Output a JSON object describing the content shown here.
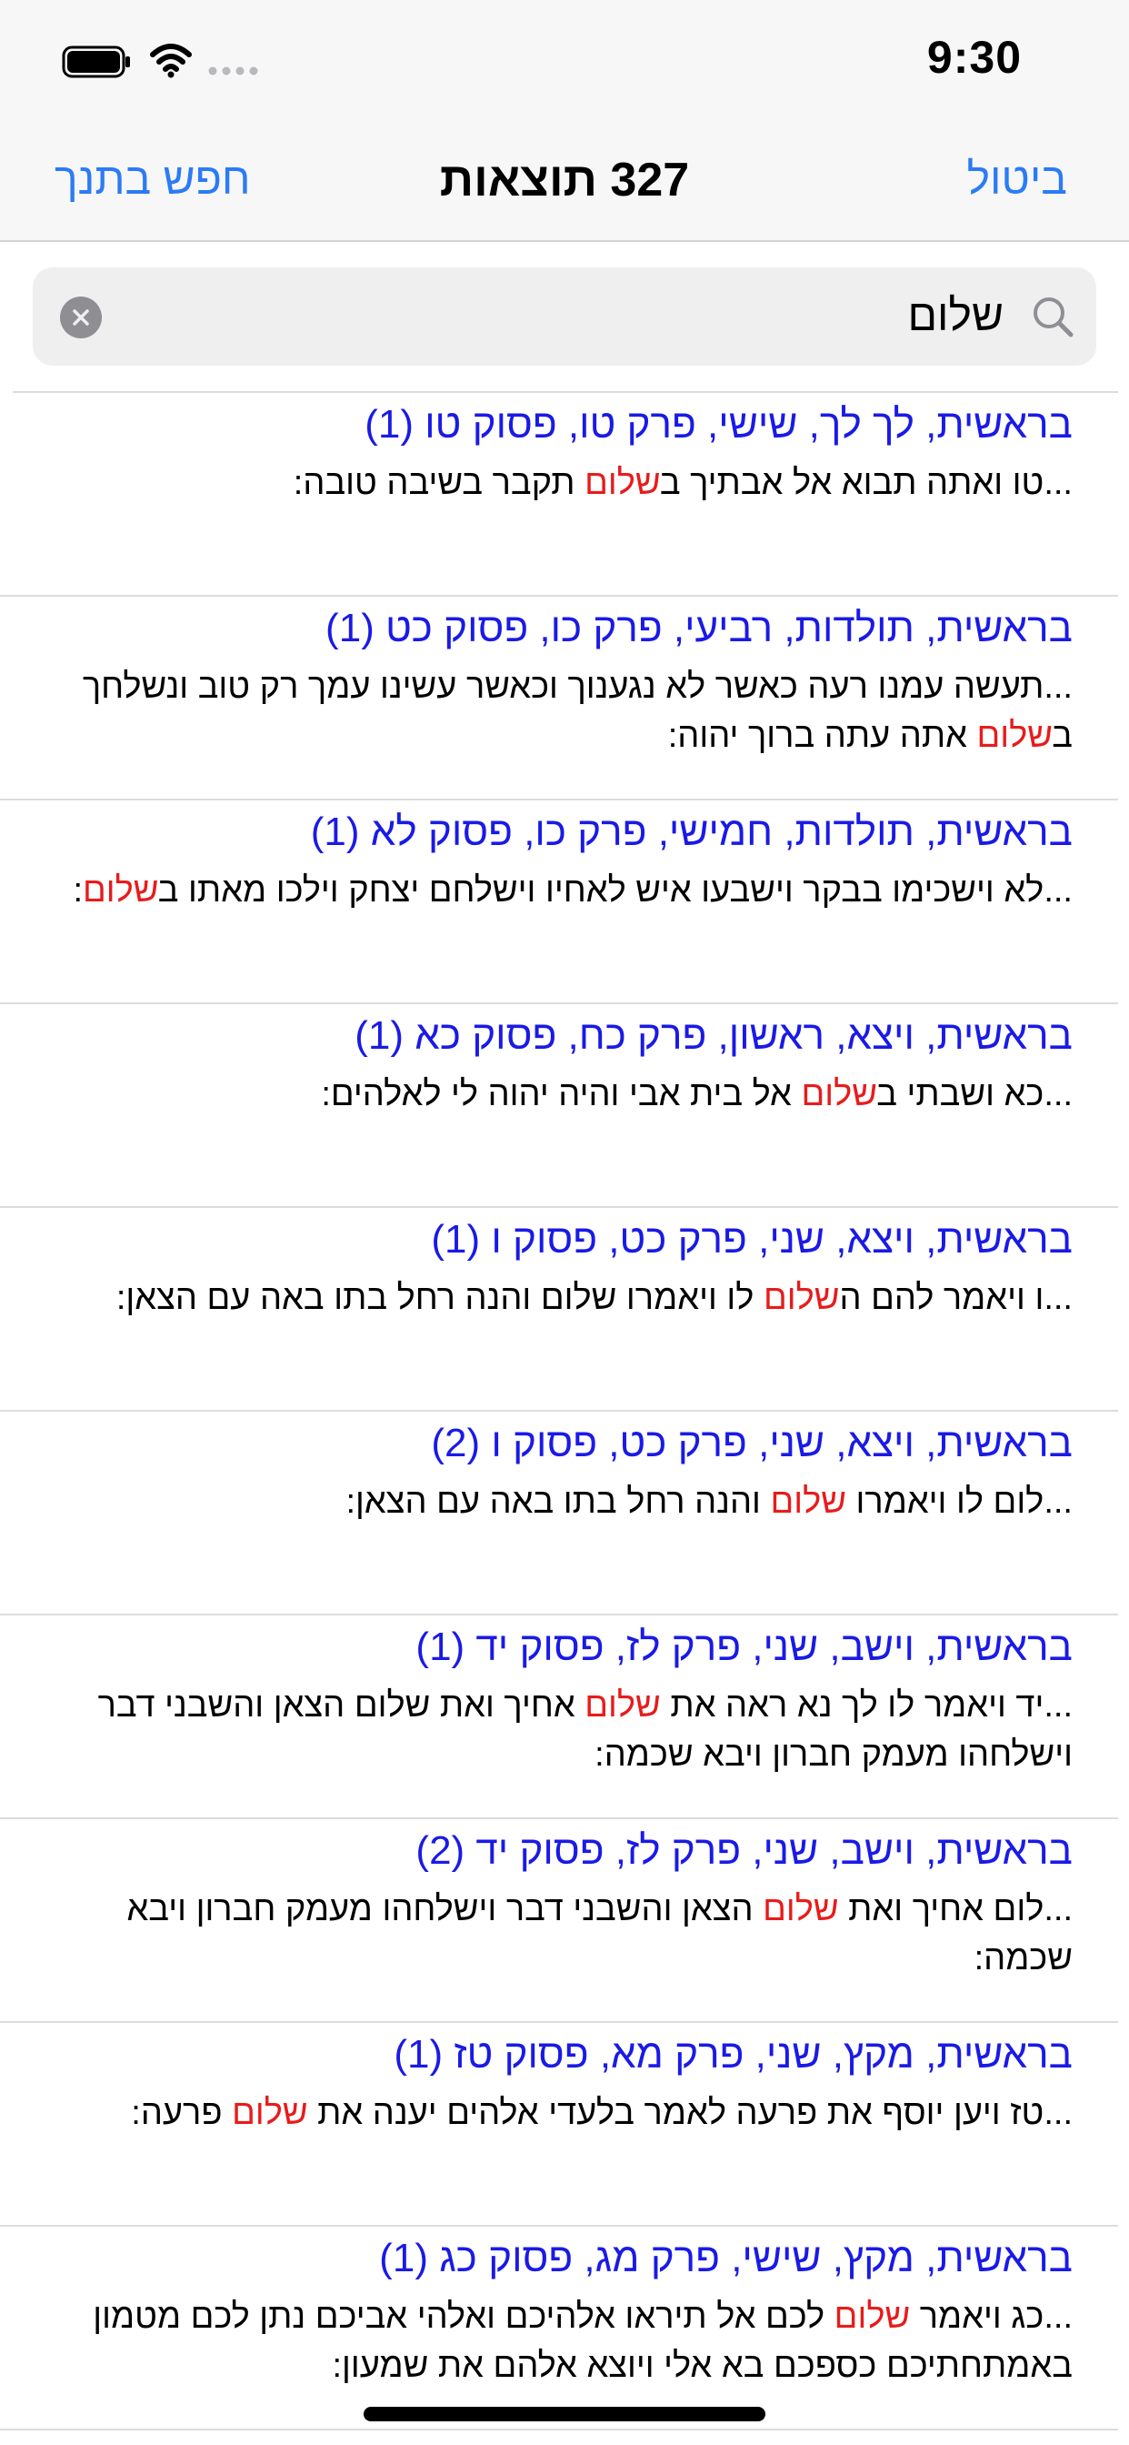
{
  "status_bar": {
    "time": "9:30"
  },
  "nav": {
    "cancel_label": "ביטול",
    "title": "327 תוצאות",
    "search_tanakh_label": "חפש בתנך"
  },
  "search": {
    "value": "שלום"
  },
  "colors": {
    "accent": "#2b7bf6",
    "reference": "#1a1ae6",
    "highlight": "#e81b1b"
  },
  "results": [
    {
      "ref": "בראשית, לך לך, שישי, פרק טו, פסוק טו (1)",
      "before": "...טו ואתה תבוא אל אבתיך ב",
      "match": "שלום",
      "after": " תקבר בשיבה טובה:"
    },
    {
      "ref": "בראשית, תולדות, רביעי, פרק כו, פסוק כט (1)",
      "before": "...תעשה עמנו רעה כאשר לא נגענוך וכאשר עשינו עמך רק טוב ונשלחך ב",
      "match": "שלום",
      "after": " אתה עתה ברוך יהוה:"
    },
    {
      "ref": "בראשית, תולדות, חמישי, פרק כו, פסוק לא (1)",
      "before": "...לא וישכימו בבקר וישבעו איש לאחיו וישלחם יצחק וילכו מאתו ב",
      "match": "שלום",
      "after": ":"
    },
    {
      "ref": "בראשית, ויצא, ראשון, פרק כח, פסוק כא (1)",
      "before": "...כא ושבתי ב",
      "match": "שלום",
      "after": " אל בית אבי והיה יהוה לי לאלהים:"
    },
    {
      "ref": "בראשית, ויצא, שני, פרק כט, פסוק ו (1)",
      "before": "...ו ויאמר להם ה",
      "match": "שלום",
      "after": " לו ויאמרו שלום והנה רחל בתו באה עם הצאן:"
    },
    {
      "ref": "בראשית, ויצא, שני, פרק כט, פסוק ו (2)",
      "before": "...לום לו ויאמרו ",
      "match": "שלום",
      "after": " והנה רחל בתו באה עם הצאן:"
    },
    {
      "ref": "בראשית, וישב, שני, פרק לז, פסוק יד (1)",
      "before": "...יד ויאמר לו לך נא ראה את ",
      "match": "שלום",
      "after": " אחיך ואת שלום הצאן והשבני דבר וישלחהו מעמק חברון ויבא שכמה:"
    },
    {
      "ref": "בראשית, וישב, שני, פרק לז, פסוק יד (2)",
      "before": "...לום אחיך ואת ",
      "match": "שלום",
      "after": " הצאן והשבני דבר וישלחהו מעמק חברון ויבא שכמה:"
    },
    {
      "ref": "בראשית, מקץ, שני, פרק מא, פסוק טז (1)",
      "before": "...טז ויען יוסף את פרעה לאמר בלעדי אלהים יענה את ",
      "match": "שלום",
      "after": " פרעה:"
    },
    {
      "ref": "בראשית, מקץ, שישי, פרק מג, פסוק כג (1)",
      "before": "...כג ויאמר ",
      "match": "שלום",
      "after": " לכם אל תיראו אלהיכם ואלהי אביכם נתן לכם מטמון באמתחתיכם כספכם בא אלי ויוצא אלהם את שמעון:"
    }
  ]
}
